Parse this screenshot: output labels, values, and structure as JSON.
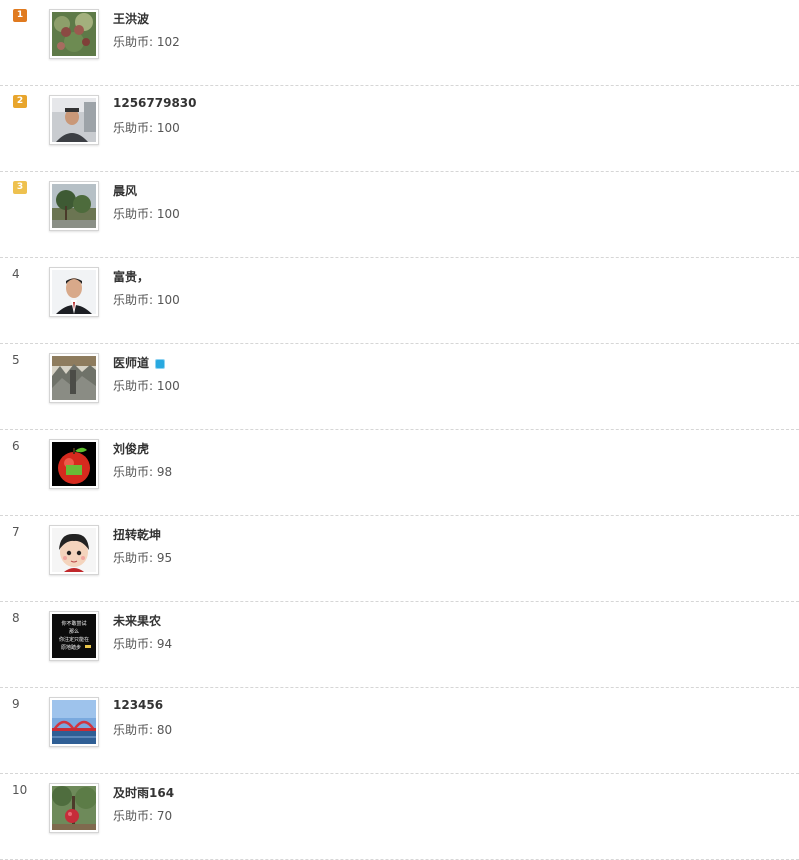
{
  "colors": {
    "rank1": "#e07a1f",
    "rank2": "#e8a52c",
    "rank3": "#eec14f"
  },
  "coin_label": "乐助币: ",
  "users": [
    {
      "rank": "1",
      "name": "王洪波",
      "coins": "102",
      "avatar": "fruit-tree-photo"
    },
    {
      "rank": "2",
      "name": "1256779830",
      "coins": "100",
      "avatar": "man-in-car-photo"
    },
    {
      "rank": "3",
      "name": "晨风",
      "coins": "100",
      "avatar": "garden-photo"
    },
    {
      "rank": "4",
      "name": "富贵，",
      "coins": "100",
      "avatar": "portrait-photo"
    },
    {
      "rank": "5",
      "name": "医师道",
      "coins": "100",
      "avatar": "mountain-photo",
      "verified": true
    },
    {
      "rank": "6",
      "name": "刘俊虎",
      "coins": "98",
      "avatar": "red-apple-image"
    },
    {
      "rank": "7",
      "name": "扭转乾坤",
      "coins": "95",
      "avatar": "cartoon-girl-image"
    },
    {
      "rank": "8",
      "name": "未来果农",
      "coins": "94",
      "avatar": "text-quote-image",
      "avatar_text": [
        "你不敢尝试",
        "那么",
        "你注定只能在",
        "原地踏步"
      ]
    },
    {
      "rank": "9",
      "name": "123456",
      "coins": "80",
      "avatar": "bridge-photo"
    },
    {
      "rank": "10",
      "name": "及时雨164",
      "coins": "70",
      "avatar": "tree-fruit-photo"
    }
  ]
}
